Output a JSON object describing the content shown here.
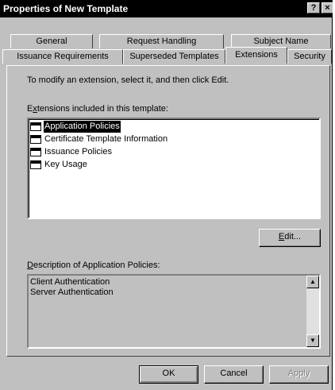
{
  "window": {
    "title": "Properties of New Template",
    "help_label": "?",
    "close_label": "×"
  },
  "tabs": {
    "row1": [
      "General",
      "Request Handling",
      "Subject Name"
    ],
    "row2": [
      "Issuance Requirements",
      "Superseded Templates",
      "Extensions",
      "Security"
    ],
    "selected": "Extensions"
  },
  "extensions_page": {
    "instruction": "To modify an extension, select it, and then click Edit.",
    "list_label_prefix": "E",
    "list_label_mnemonic": "x",
    "list_label_rest": "tensions included in this template:",
    "items": [
      {
        "label": "Application Policies",
        "icon": "extension-icon",
        "selected": true
      },
      {
        "label": "Certificate Template Information",
        "icon": "extension-icon",
        "selected": false
      },
      {
        "label": "Issuance Policies",
        "icon": "extension-icon",
        "selected": false
      },
      {
        "label": "Key Usage",
        "icon": "extension-icon",
        "selected": false
      }
    ],
    "edit_mnemonic": "E",
    "edit_rest": "dit...",
    "description_mnemonic": "D",
    "description_rest": "escription of Application Policies:",
    "description_lines": [
      "Client Authentication",
      "Server Authentication"
    ]
  },
  "footer": {
    "ok_label": "OK",
    "cancel_label": "Cancel",
    "apply_label": "Apply"
  }
}
